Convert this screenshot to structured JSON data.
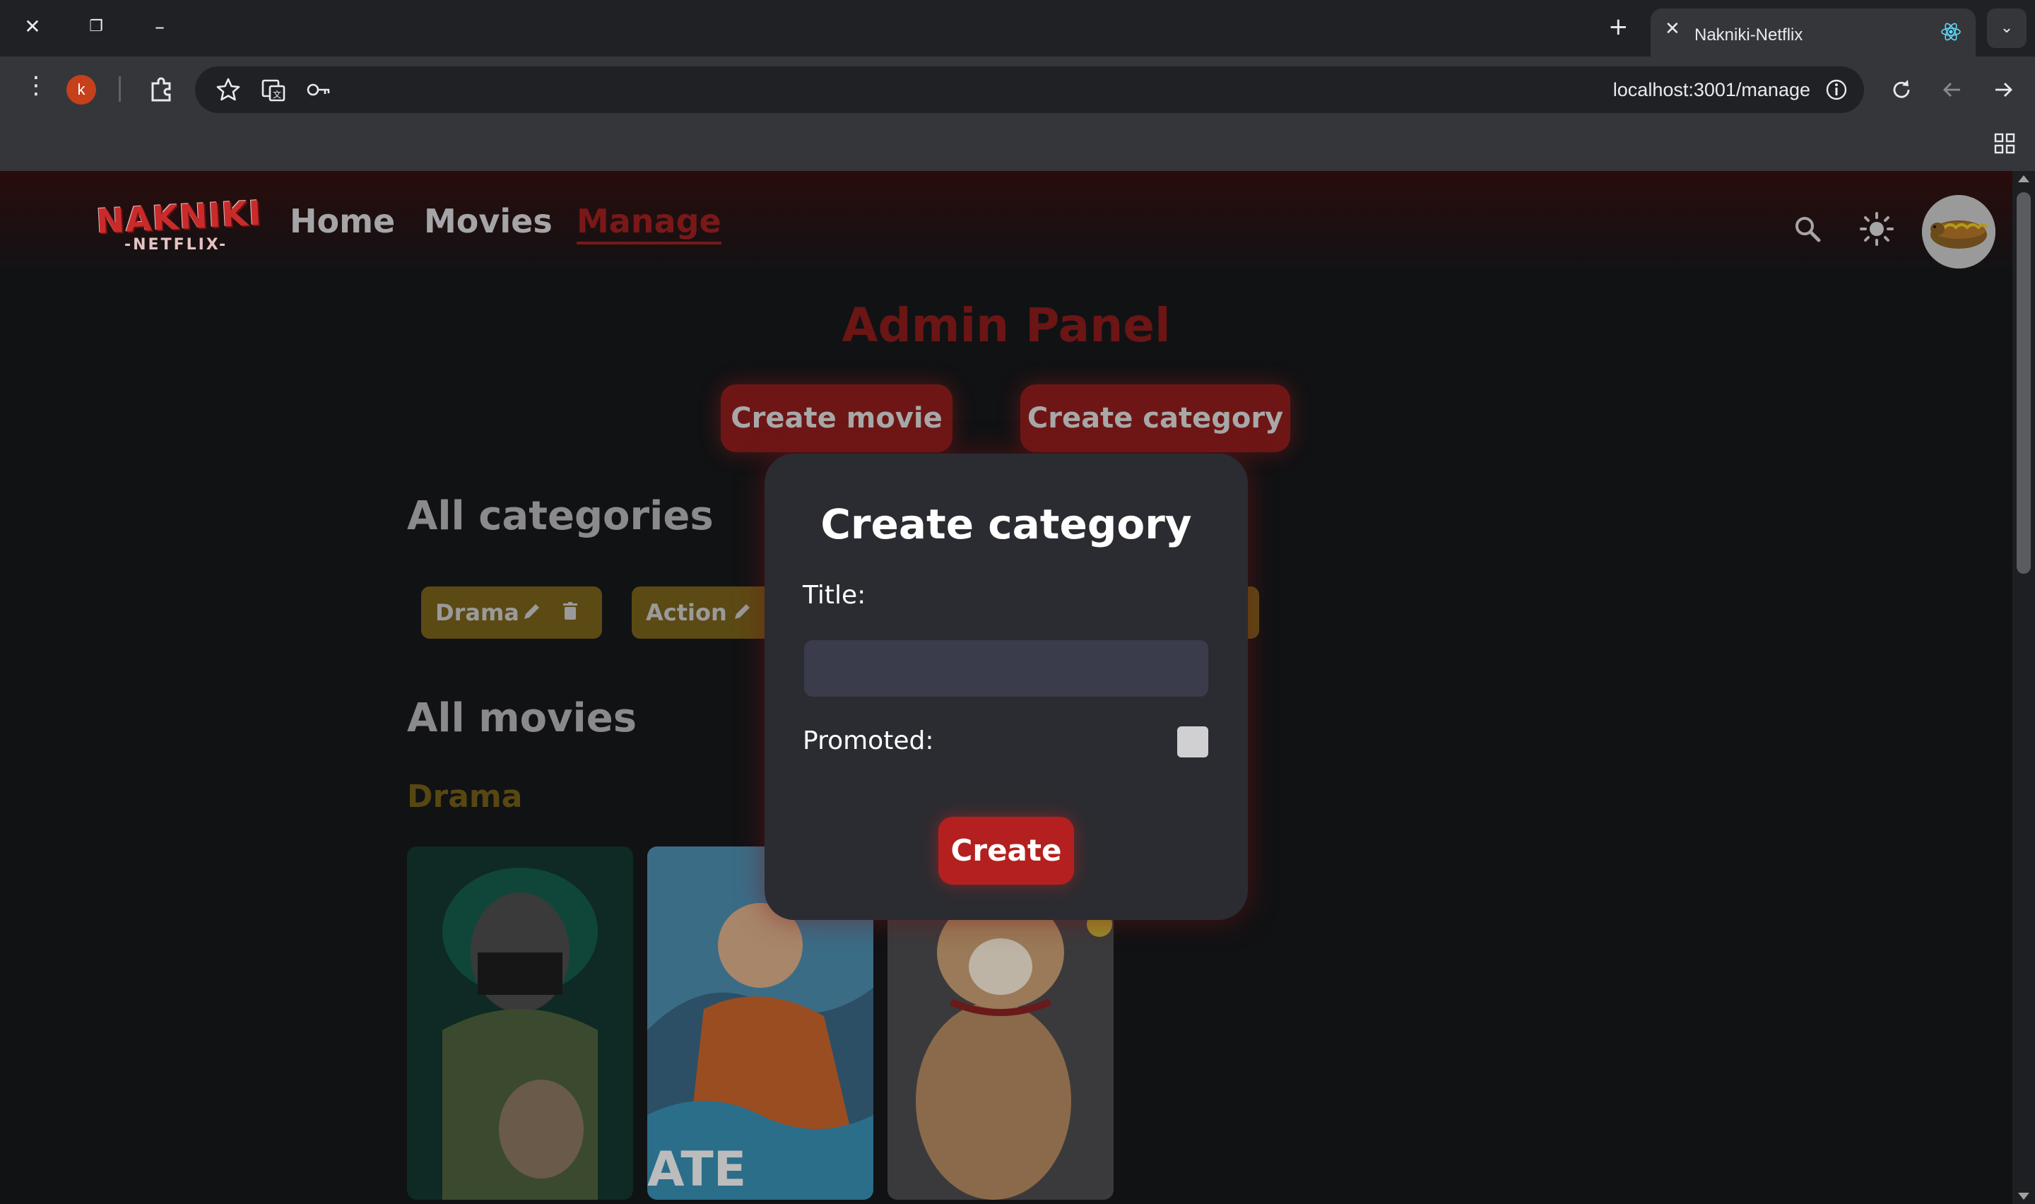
{
  "browser": {
    "tab_title": "Nakniki-Netflix",
    "profile_initial": "k",
    "url": "localhost:3001/manage",
    "icons": [
      "close-icon",
      "restore-icon",
      "minimize-icon",
      "new-tab-icon",
      "tab-close-icon",
      "react-icon",
      "tab-list-icon",
      "menu-icon",
      "extensions-icon",
      "star-icon",
      "translate-icon",
      "password-key-icon",
      "info-icon",
      "reload-icon",
      "back-icon",
      "forward-icon",
      "apps-grid-icon"
    ]
  },
  "navbar": {
    "logo_main": "NAKNIKI",
    "logo_sub": "-NETFLIX-",
    "links": [
      "Home",
      "Movies",
      "Manage"
    ],
    "active_link": "Manage",
    "icons": [
      "search-icon",
      "sun-icon",
      "avatar"
    ]
  },
  "admin": {
    "title": "Admin Panel",
    "create_movie": "Create movie",
    "create_category": "Create category",
    "all_categories": "All categories",
    "categories": [
      "Drama",
      "Action"
    ],
    "all_movies": "All movies",
    "drama_heading": "Drama"
  },
  "modal": {
    "title": "Create category",
    "title_label": "Title:",
    "title_value": "",
    "promoted_label": "Promoted:",
    "promoted_checked": false,
    "create_label": "Create",
    "poster_text": "ATE"
  },
  "colors": {
    "accent": "#b4201f",
    "chip": "#5c4a14",
    "modal_bg": "#2b2c31"
  }
}
